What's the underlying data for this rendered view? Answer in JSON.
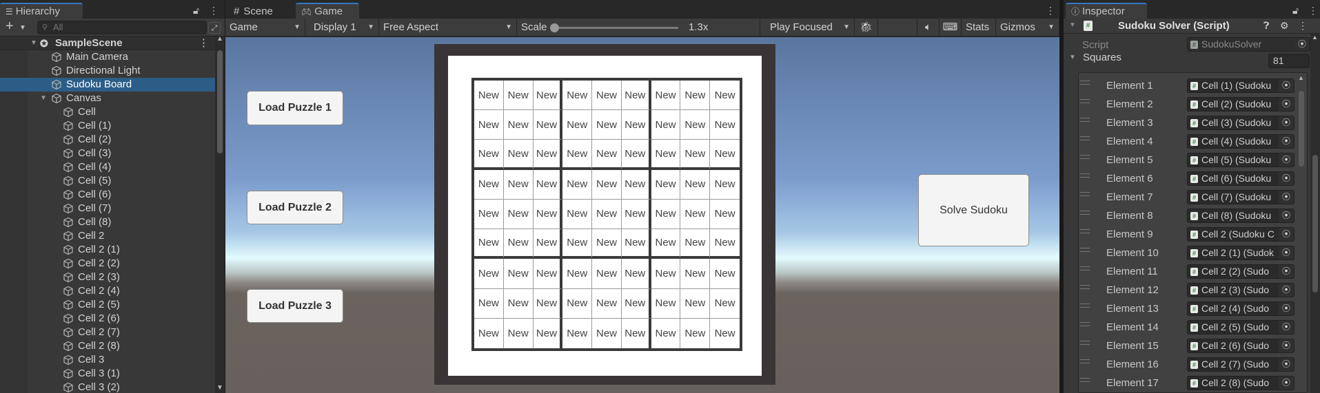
{
  "hierarchy": {
    "tab_label": "Hierarchy",
    "search_placeholder": "All",
    "scene": "SampleScene",
    "items": [
      {
        "label": "Main Camera",
        "depth": 1,
        "selected": false
      },
      {
        "label": "Directional Light",
        "depth": 1,
        "selected": false
      },
      {
        "label": "Sudoku Board",
        "depth": 1,
        "selected": true
      },
      {
        "label": "Canvas",
        "depth": 1,
        "selected": false,
        "expanded": true
      },
      {
        "label": "Cell",
        "depth": 2
      },
      {
        "label": "Cell (1)",
        "depth": 2
      },
      {
        "label": "Cell (2)",
        "depth": 2
      },
      {
        "label": "Cell (3)",
        "depth": 2
      },
      {
        "label": "Cell (4)",
        "depth": 2
      },
      {
        "label": "Cell (5)",
        "depth": 2
      },
      {
        "label": "Cell (6)",
        "depth": 2
      },
      {
        "label": "Cell (7)",
        "depth": 2
      },
      {
        "label": "Cell (8)",
        "depth": 2
      },
      {
        "label": "Cell 2",
        "depth": 2
      },
      {
        "label": "Cell 2 (1)",
        "depth": 2
      },
      {
        "label": "Cell 2 (2)",
        "depth": 2
      },
      {
        "label": "Cell 2 (3)",
        "depth": 2
      },
      {
        "label": "Cell 2 (4)",
        "depth": 2
      },
      {
        "label": "Cell 2 (5)",
        "depth": 2
      },
      {
        "label": "Cell 2 (6)",
        "depth": 2
      },
      {
        "label": "Cell 2 (7)",
        "depth": 2
      },
      {
        "label": "Cell 2 (8)",
        "depth": 2
      },
      {
        "label": "Cell 3",
        "depth": 2
      },
      {
        "label": "Cell 3 (1)",
        "depth": 2
      },
      {
        "label": "Cell 3 (2)",
        "depth": 2
      }
    ]
  },
  "game": {
    "tabs": [
      {
        "label": "Scene",
        "icon": "hash-icon",
        "active": false
      },
      {
        "label": "Game",
        "icon": "gamepad-icon",
        "active": true
      }
    ],
    "toolbar": {
      "mode": "Game",
      "display": "Display 1",
      "aspect": "Free Aspect",
      "scale_label": "Scale",
      "scale_value": "1.3x",
      "scale_slider_fraction": 0.0,
      "play_mode": "Play Focused",
      "stats": "Stats",
      "gizmos": "Gizmos"
    },
    "buttons": {
      "load1": "Load Puzzle 1",
      "load2": "Load Puzzle 2",
      "load3": "Load Puzzle 3",
      "solve": "Solve Sudoku"
    },
    "cell_text": "New",
    "board_size": 9
  },
  "inspector": {
    "tab_label": "Inspector",
    "component_title": "Sudoku Solver (Script)",
    "script_label": "Script",
    "script_value": "SudokuSolver",
    "squares_label": "Squares",
    "squares_count": "81",
    "elements": [
      {
        "label": "Element 1",
        "value": "Cell (1) (Sudoku"
      },
      {
        "label": "Element 2",
        "value": "Cell (2) (Sudoku"
      },
      {
        "label": "Element 3",
        "value": "Cell (3) (Sudoku"
      },
      {
        "label": "Element 4",
        "value": "Cell (4) (Sudoku"
      },
      {
        "label": "Element 5",
        "value": "Cell (5) (Sudoku"
      },
      {
        "label": "Element 6",
        "value": "Cell (6) (Sudoku"
      },
      {
        "label": "Element 7",
        "value": "Cell (7) (Sudoku"
      },
      {
        "label": "Element 8",
        "value": "Cell (8) (Sudoku"
      },
      {
        "label": "Element 9",
        "value": "Cell 2 (Sudoku C"
      },
      {
        "label": "Element 10",
        "value": "Cell 2 (1) (Sudok"
      },
      {
        "label": "Element 11",
        "value": "Cell 2 (2) (Sudo"
      },
      {
        "label": "Element 12",
        "value": "Cell 2 (3) (Sudo"
      },
      {
        "label": "Element 13",
        "value": "Cell 2 (4) (Sudo"
      },
      {
        "label": "Element 14",
        "value": "Cell 2 (5) (Sudo"
      },
      {
        "label": "Element 15",
        "value": "Cell 2 (6) (Sudo"
      },
      {
        "label": "Element 16",
        "value": "Cell 2 (7) (Sudo"
      },
      {
        "label": "Element 17",
        "value": "Cell 2 (8) (Sudo"
      }
    ]
  }
}
